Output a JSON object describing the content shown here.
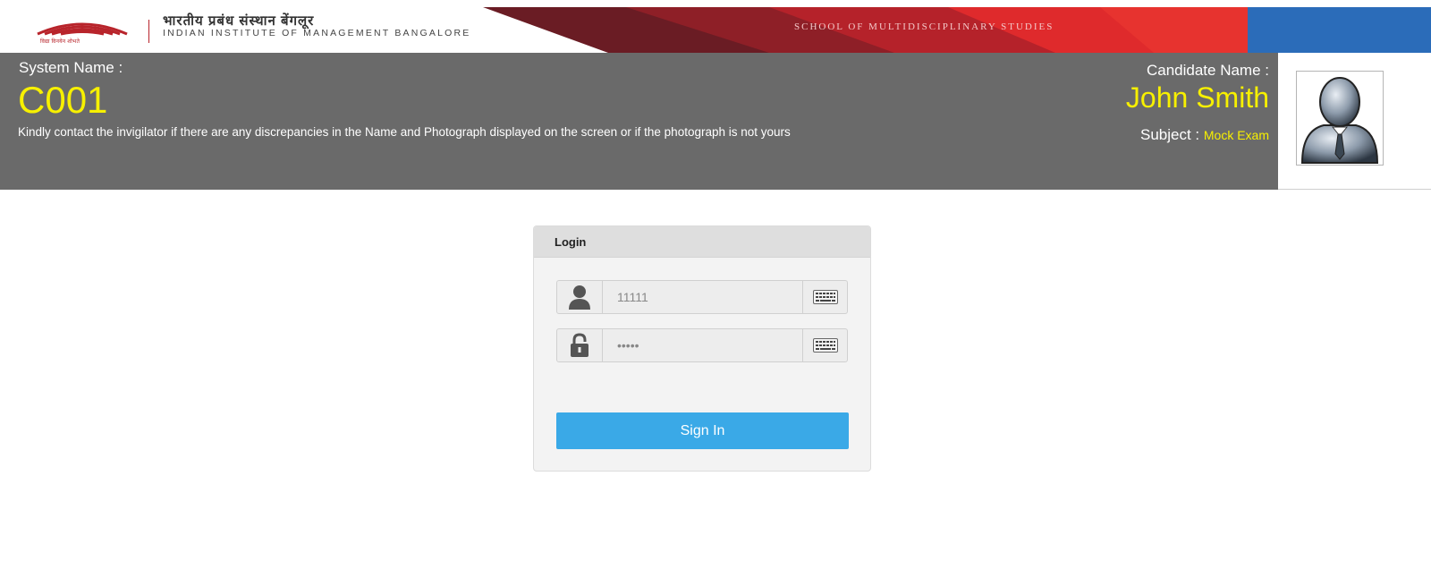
{
  "banner": {
    "logo_text": "IIMB",
    "logo_tagline": "विद्या विनयेन शोभते",
    "institute_hindi": "भारतीय प्रबंध संस्थान बेंगलूर",
    "institute_english": "INDIAN INSTITUTE OF MANAGEMENT BANGALORE",
    "school_name": "SCHOOL OF MULTIDISCIPLINARY STUDIES",
    "colors": {
      "brand_red": "#b8242b",
      "dark_maroon": "#5b1c22",
      "bright_red": "#e1262a",
      "blue": "#2b6cb9"
    }
  },
  "info": {
    "system_name_label": "System Name :",
    "system_name_value": "C001",
    "notice": "Kindly contact the invigilator if there are any discrepancies in the Name and Photograph displayed on the screen or if the photograph is not yours",
    "candidate_name_label": "Candidate Name :",
    "candidate_name_value": "John Smith",
    "subject_label": "Subject :",
    "subject_value": "Mock Exam",
    "photo_icon": "candidate-avatar-icon",
    "colors": {
      "bar_bg": "#6a6a6a",
      "highlight": "#f7f000"
    }
  },
  "login": {
    "title": "Login",
    "username_value": "11111",
    "username_icon": "user-icon",
    "password_value": "11111",
    "password_icon": "lock-icon",
    "keyboard_icon": "keyboard-icon",
    "sign_in_label": "Sign In",
    "colors": {
      "button": "#3aa9e7"
    }
  }
}
